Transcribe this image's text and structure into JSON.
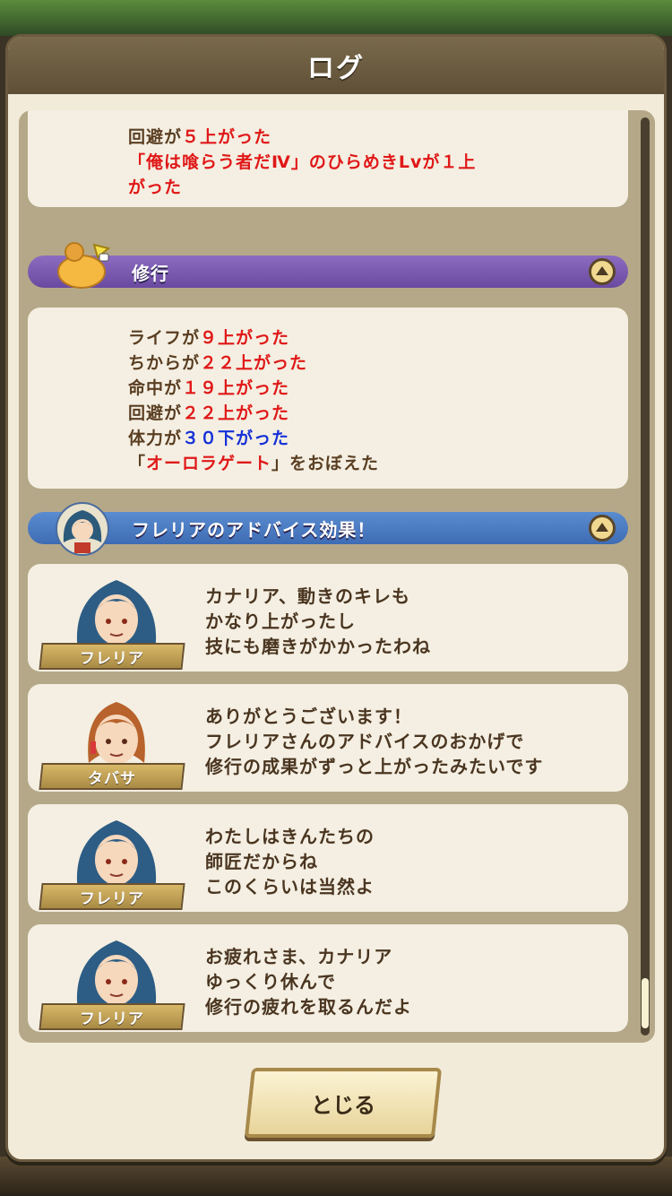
{
  "dialog": {
    "title": "ログ",
    "close_label": "とじる"
  },
  "top_card": {
    "lines": [
      {
        "prefix": "回避が",
        "value": "５上がった",
        "suffix": ""
      },
      {
        "prefix": "「俺は喰らう者だⅣ」のひらめきLvが１上",
        "value": "",
        "suffix": ""
      },
      {
        "prefix": "がった",
        "value": "",
        "suffix": ""
      }
    ]
  },
  "training": {
    "label": "修行",
    "lines": [
      {
        "prefix": "ライフが",
        "value": "９上がった",
        "color": "red",
        "suffix": ""
      },
      {
        "prefix": "ちからが",
        "value": "２２上がった",
        "color": "red",
        "suffix": ""
      },
      {
        "prefix": "命中が",
        "value": "１９上がった",
        "color": "red",
        "suffix": ""
      },
      {
        "prefix": "回避が",
        "value": "２２上がった",
        "color": "red",
        "suffix": ""
      },
      {
        "prefix": "体力が",
        "value": "３０下がった",
        "color": "blue",
        "suffix": ""
      },
      {
        "prefix": "「",
        "value": "オーロラゲート",
        "color": "red",
        "suffix": "」をおぼえた"
      }
    ]
  },
  "advice": {
    "label": "フレリアのアドバイス効果！",
    "messages": [
      {
        "speaker": "フレリア",
        "lines": [
          "カナリア、動きのキレも",
          "かなり上がったし",
          "技にも磨きがかかったわね"
        ]
      },
      {
        "speaker": "タバサ",
        "lines": [
          "ありがとうございます！",
          "フレリアさんのアドバイスのおかげで",
          "修行の成果がずっと上がったみたいです"
        ]
      },
      {
        "speaker": "フレリア",
        "lines": [
          "わたしはきんたちの",
          "師匠だからね",
          "このくらいは当然よ"
        ]
      },
      {
        "speaker": "フレリア",
        "lines": [
          "お疲れさま、カナリア",
          "ゆっくり休んで",
          "修行の疲れを取るんだよ"
        ]
      }
    ]
  },
  "colors": {
    "up": "#e01818",
    "down": "#1530d8",
    "training_bar": "#7a5ab0",
    "advice_bar": "#4e7cc4"
  }
}
